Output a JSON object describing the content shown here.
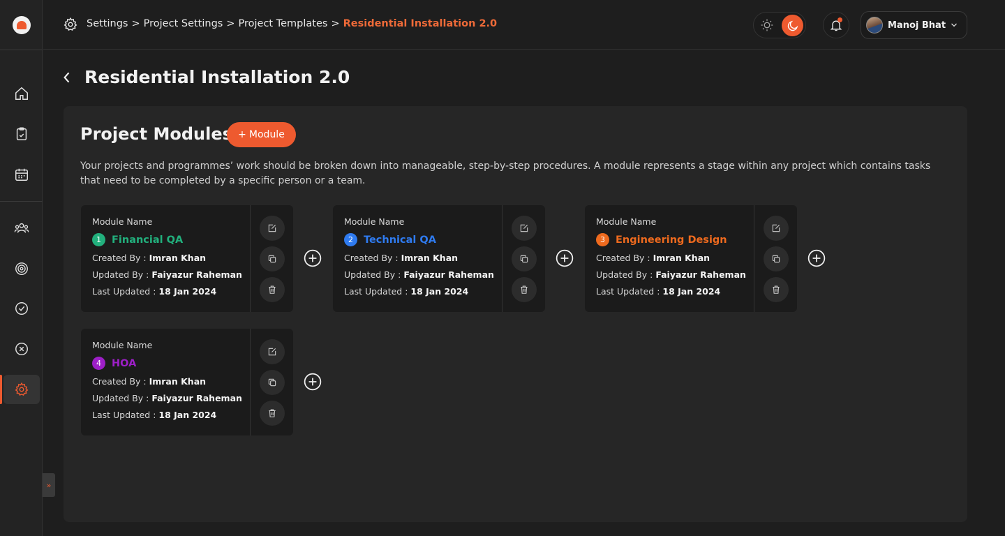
{
  "colors": {
    "accent": "#ee5a2f",
    "module_1": "#22b07d",
    "module_2": "#2f7bf0",
    "module_3": "#ee6a1e",
    "module_4": "#9d1fc7"
  },
  "sidebar": {
    "items": [
      {
        "icon": "home-icon"
      },
      {
        "icon": "clipboard-icon"
      },
      {
        "icon": "calendar-icon"
      },
      {
        "icon": "team-icon"
      },
      {
        "icon": "target-icon"
      },
      {
        "icon": "check-circle-icon"
      },
      {
        "icon": "x-circle-icon"
      },
      {
        "icon": "gear-icon",
        "active": true
      }
    ],
    "expand_label": "»"
  },
  "header": {
    "breadcrumb": [
      "Settings",
      "Project Settings",
      "Project Templates"
    ],
    "breadcrumb_separator": ">",
    "breadcrumb_current": "Residential Installation 2.0",
    "user_name": "Manoj Bhat"
  },
  "page": {
    "title": "Residential Installation 2.0"
  },
  "panel": {
    "title": "Project Modules",
    "add_button_plus": "+",
    "add_button_label": "Module",
    "description": "Your projects and programmes’ work should be broken down into manageable, step-by-step procedures. A module represents a stage within any project which contains tasks that need to be completed by a specific person or a team."
  },
  "modules": [
    {
      "number": "1",
      "label": "Module Name",
      "name": "Financial QA",
      "created_by_label": "Created By : ",
      "created_by": "Imran Khan",
      "updated_by_label": "Updated By : ",
      "updated_by": "Faiyazur Raheman",
      "last_updated_label": "Last Updated : ",
      "last_updated": "18 Jan 2024"
    },
    {
      "number": "2",
      "label": "Module Name",
      "name": "Technical QA",
      "created_by_label": "Created By : ",
      "created_by": "Imran Khan",
      "updated_by_label": "Updated By : ",
      "updated_by": "Faiyazur Raheman",
      "last_updated_label": "Last Updated : ",
      "last_updated": "18 Jan 2024"
    },
    {
      "number": "3",
      "label": "Module Name",
      "name": "Engineering Design",
      "created_by_label": "Created By : ",
      "created_by": "Imran Khan",
      "updated_by_label": "Updated By : ",
      "updated_by": "Faiyazur Raheman",
      "last_updated_label": "Last Updated : ",
      "last_updated": "18 Jan 2024"
    },
    {
      "number": "4",
      "label": "Module Name",
      "name": "HOA",
      "created_by_label": "Created By : ",
      "created_by": "Imran Khan",
      "updated_by_label": "Updated By : ",
      "updated_by": "Faiyazur Raheman",
      "last_updated_label": "Last Updated : ",
      "last_updated": "18 Jan 2024"
    }
  ]
}
